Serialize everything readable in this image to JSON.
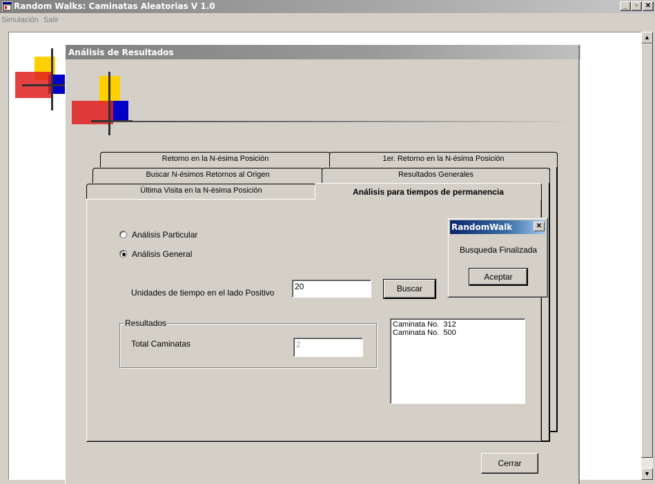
{
  "window": {
    "title": "Random Walks: Caminatas Aleatorias V 1.0",
    "controls": {
      "minimize": "_",
      "maximize": "▫",
      "close": "✕"
    }
  },
  "menu": [
    {
      "label": "Simulación"
    },
    {
      "label": "Salir"
    }
  ],
  "child_window": {
    "title": "Análisis de Resultados"
  },
  "tabs": {
    "row1": [
      "Retorno en la N-ésima Posición",
      "1er. Retorno en la N-ésima Posición"
    ],
    "row2": [
      "Buscar N-ésimos Retornos al Origen",
      "Resultados Generales"
    ],
    "row3": [
      "Última Visita en la N-ésima Posición",
      "Análisis para tiempos de permanencia"
    ],
    "active": "Análisis para tiempos de permanencia"
  },
  "form": {
    "radio_particular": "Análisis Particular",
    "radio_general": "Análisis General",
    "selected_radio": "general",
    "time_units_label": "Unidades de tiempo en el lado Positivo",
    "time_units_value": "20",
    "search_button": "Buscar",
    "results_group": "Resultados",
    "total_label": "Total Caminatas",
    "total_value": "2",
    "results_list": [
      "Caminata No.  312",
      "Caminata No.  500"
    ],
    "close_button": "Cerrar"
  },
  "dialog": {
    "title": "RandomWalk",
    "close": "✕",
    "message": "Busqueda Finalizada",
    "ok_button": "Aceptar"
  },
  "colors": {
    "inactive_caption": "#808080",
    "active_caption": "#0a246a",
    "face": "#d4d0c8",
    "logo_yellow": "#ffd000",
    "logo_red": "#e00000",
    "logo_blue": "#0000c8"
  }
}
